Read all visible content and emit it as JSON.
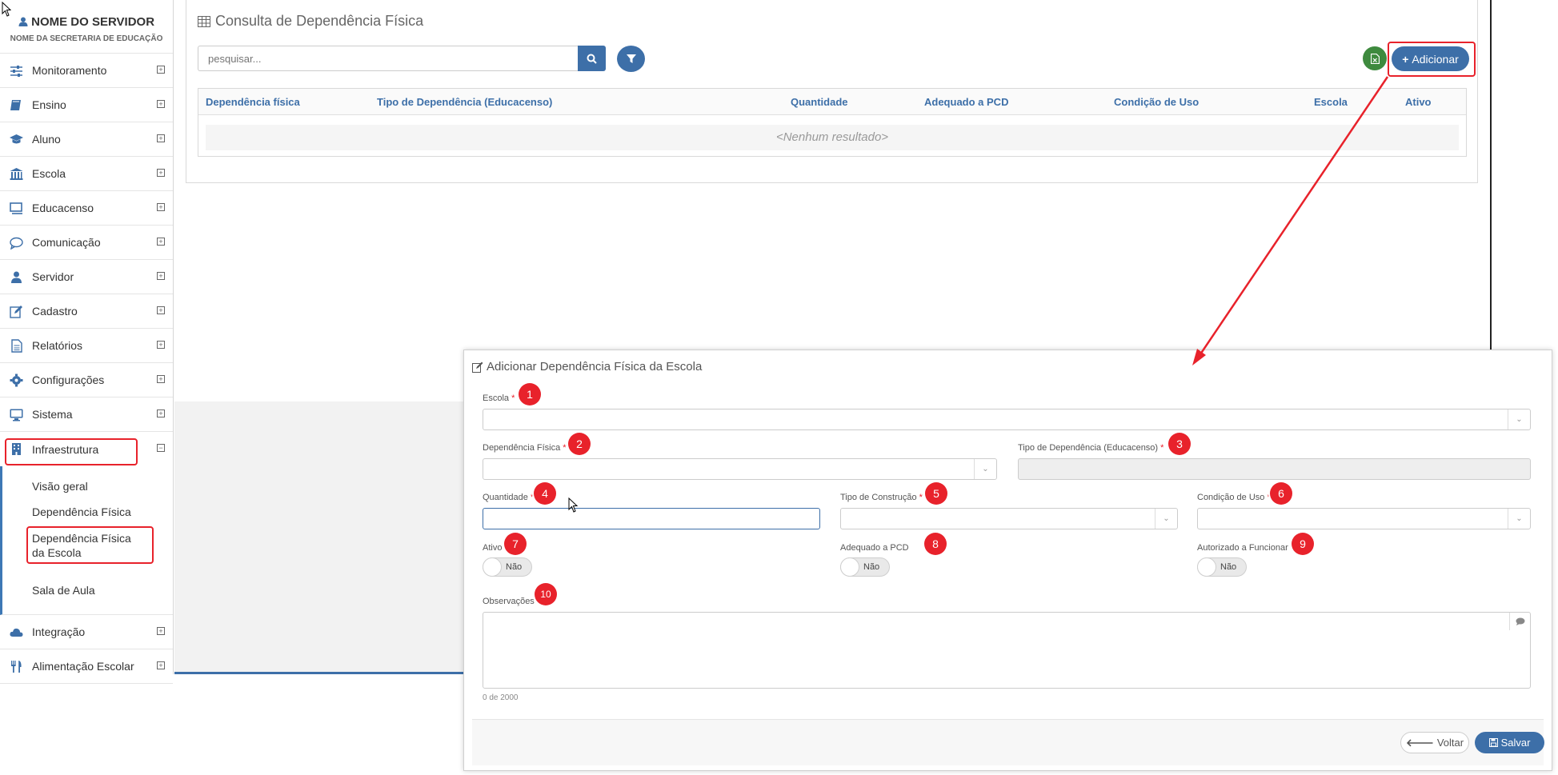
{
  "sidebar": {
    "user_name": "NOME DO SERVIDOR",
    "user_sub": "NOME DA SECRETARIA DE EDUCAÇÃO",
    "items": [
      {
        "label": "Monitoramento",
        "icon": "sliders-icon"
      },
      {
        "label": "Ensino",
        "icon": "book-icon"
      },
      {
        "label": "Aluno",
        "icon": "graduation-cap-icon"
      },
      {
        "label": "Escola",
        "icon": "institution-icon"
      },
      {
        "label": "Educacenso",
        "icon": "monitor-icon"
      },
      {
        "label": "Comunicação",
        "icon": "chat-icon"
      },
      {
        "label": "Servidor",
        "icon": "user-icon"
      },
      {
        "label": "Cadastro",
        "icon": "edit-icon"
      },
      {
        "label": "Relatórios",
        "icon": "file-text-icon"
      },
      {
        "label": "Configurações",
        "icon": "gear-icon"
      },
      {
        "label": "Sistema",
        "icon": "desktop-icon"
      },
      {
        "label": "Infraestrutura",
        "icon": "building-icon"
      },
      {
        "label": "Integração",
        "icon": "cloud-icon"
      },
      {
        "label": "Alimentação Escolar",
        "icon": "cutlery-icon"
      }
    ],
    "sub_items": [
      "Visão geral",
      "Dependência Física",
      "Dependência Física da Escola",
      "Sala de Aula"
    ],
    "toggle_plus": "⊞",
    "toggle_minus": "⊟"
  },
  "panel": {
    "title": "Consulta de Dependência Física",
    "search_placeholder": "pesquisar...",
    "add_label": "Adicionar",
    "columns": [
      "Dependência física",
      "Tipo de Dependência (Educacenso)",
      "Quantidade",
      "Adequado a PCD",
      "Condição de Uso",
      "Escola",
      "Ativo"
    ],
    "empty_text": "<Nenhum resultado>"
  },
  "modal": {
    "title": "Adicionar Dependência Física da Escola",
    "fields": {
      "escola": "Escola",
      "dependencia": "Dependência Física",
      "tipo_dependencia": "Tipo de Dependência (Educacenso)",
      "quantidade": "Quantidade",
      "tipo_construcao": "Tipo de Construção",
      "condicao_uso": "Condição de Uso",
      "ativo": "Ativo",
      "adequado_pcd": "Adequado a PCD",
      "autorizado": "Autorizado a Funcionar",
      "observacoes": "Observações"
    },
    "required_mark": "*",
    "switch_off": "Não",
    "counter": "0 de 2000",
    "back_label": "Voltar",
    "save_label": "Salvar",
    "badges": [
      "1",
      "2",
      "3",
      "4",
      "5",
      "6",
      "7",
      "8",
      "9",
      "10"
    ]
  },
  "colors": {
    "primary": "#3d6fa8",
    "success": "#3e8a3e",
    "highlight": "#e8222b"
  }
}
